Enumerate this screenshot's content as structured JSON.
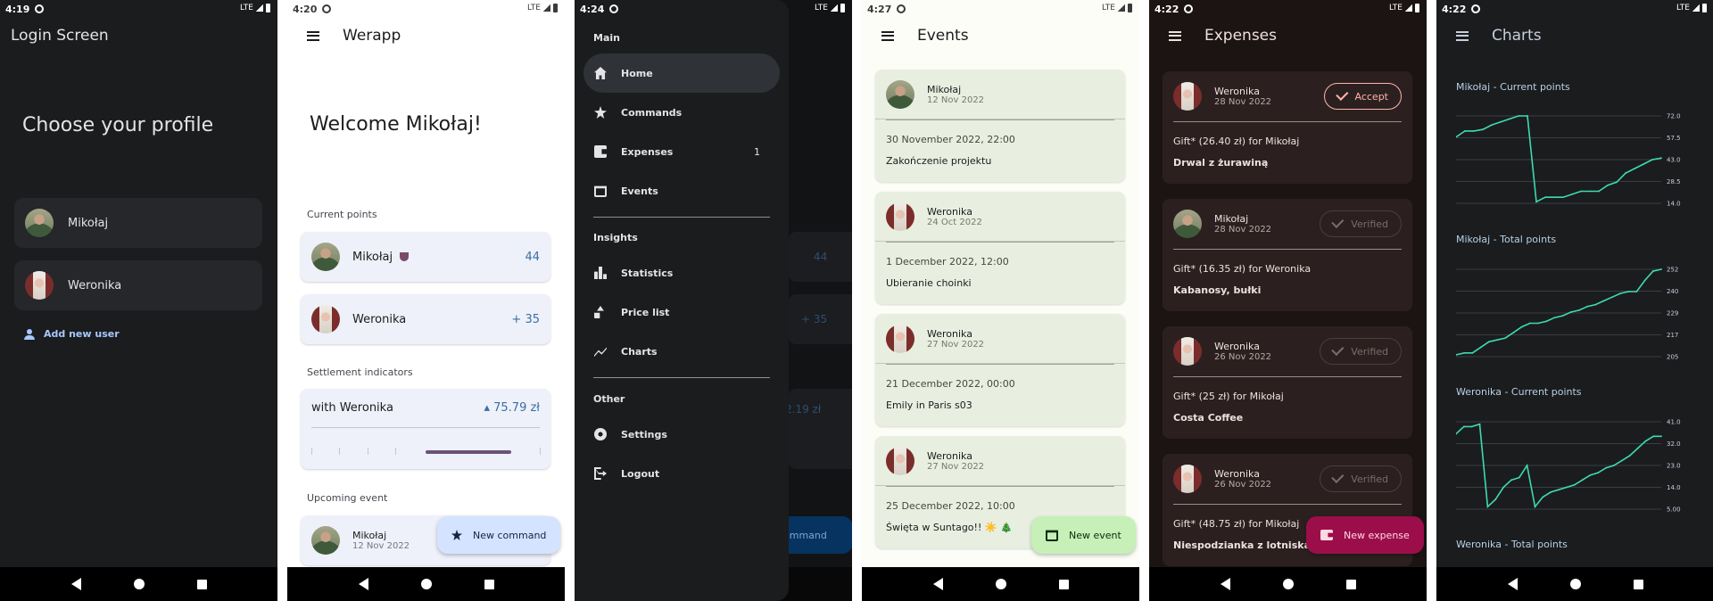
{
  "screen1": {
    "status": {
      "time": "4:19",
      "network": "LTE"
    },
    "app_title": "Login Screen",
    "heading": "Choose your profile",
    "profiles": [
      {
        "name": "Mikołaj"
      },
      {
        "name": "Weronika"
      }
    ],
    "add_user": "Add new user"
  },
  "screen2": {
    "status": {
      "time": "4:20",
      "network": "LTE"
    },
    "title": "Werapp",
    "welcome": "Welcome Mikołaj!",
    "current_points_label": "Current points",
    "points": [
      {
        "name": "Mikołaj",
        "value": "44"
      },
      {
        "name": "Weronika",
        "value": "+ 35"
      }
    ],
    "settlement_label": "Settlement indicators",
    "settlement": {
      "with": "with Weronika",
      "amount": "▴ 75.79 zł"
    },
    "upcoming_label": "Upcoming event",
    "upcoming": {
      "name": "Mikołaj",
      "date": "12 Nov 2022"
    },
    "fab": "New command"
  },
  "screen3": {
    "status": {
      "time": "4:24",
      "network": "LTE"
    },
    "sections": {
      "main": "Main",
      "insights": "Insights",
      "other": "Other"
    },
    "items": {
      "home": "Home",
      "commands": "Commands",
      "expenses": "Expenses",
      "expenses_badge": "1",
      "events": "Events",
      "statistics": "Statistics",
      "price_list": "Price list",
      "charts": "Charts",
      "settings": "Settings",
      "logout": "Logout"
    },
    "behind": {
      "points": "44",
      "points2": "+ 35",
      "amount": "2.19 zł",
      "fab": "ommand"
    }
  },
  "screen4": {
    "status": {
      "time": "4:27",
      "network": "LTE"
    },
    "title": "Events",
    "events": [
      {
        "name": "Mikołaj",
        "date": "12 Nov 2022",
        "when": "30 November 2022, 22:00",
        "what": "Zakończenie projektu"
      },
      {
        "name": "Weronika",
        "date": "24 Oct 2022",
        "when": "1 December 2022, 12:00",
        "what": "Ubieranie choinki"
      },
      {
        "name": "Weronika",
        "date": "27 Nov 2022",
        "when": "21 December 2022, 00:00",
        "what": "Emily in Paris s03"
      },
      {
        "name": "Weronika",
        "date": "27 Nov 2022",
        "when": "25 December 2022, 10:00",
        "what": "Święta w Suntago!! ☀️ 🎄"
      }
    ],
    "fab": "New event"
  },
  "screen5": {
    "status": {
      "time": "4:22",
      "network": "LTE"
    },
    "title": "Expenses",
    "expenses": [
      {
        "name": "Weronika",
        "date": "28 Nov 2022",
        "status": "Accept",
        "what": "Gift* (26.40 zł) for Mikołaj",
        "note": "Drwal z żurawiną"
      },
      {
        "name": "Mikołaj",
        "date": "28 Nov 2022",
        "status": "Verified",
        "what": "Gift* (16.35 zł) for Weronika",
        "note": "Kabanosy, bułki"
      },
      {
        "name": "Weronika",
        "date": "26 Nov 2022",
        "status": "Verified",
        "what": "Gift* (25 zł) for Mikołaj",
        "note": "Costa Coffee"
      },
      {
        "name": "Weronika",
        "date": "26 Nov 2022",
        "status": "Verified",
        "what": "Gift* (48.75 zł) for Mikołaj",
        "note": "Niespodzianka z lotniska"
      }
    ],
    "fab": "New expense"
  },
  "screen6": {
    "status": {
      "time": "4:22",
      "network": "LTE"
    },
    "title": "Charts",
    "accent": "#3ddbb0"
  },
  "chart_data": [
    {
      "type": "line",
      "title": "Mikołaj - Current points",
      "yticks": [
        "72.0",
        "57.5",
        "43.0",
        "28.5",
        "14.0"
      ],
      "ylim": [
        14.0,
        72.0
      ],
      "grid": true,
      "y": [
        58,
        62,
        62,
        63,
        66,
        68,
        70,
        72,
        72,
        15,
        18,
        18,
        18,
        20,
        22,
        22,
        22,
        26,
        28,
        34,
        37,
        40,
        43,
        44
      ]
    },
    {
      "type": "line",
      "title": "Mikołaj - Total points",
      "yticks": [
        "252",
        "240",
        "229",
        "217",
        "205"
      ],
      "ylim": [
        205,
        252
      ],
      "grid": true,
      "y": [
        206,
        207,
        207,
        210,
        213,
        214,
        215,
        218,
        221,
        223,
        223,
        224,
        226,
        227,
        229,
        230,
        232,
        233,
        235,
        237,
        239,
        240,
        240,
        246,
        251,
        252
      ]
    },
    {
      "type": "line",
      "title": "Weronika - Current points",
      "yticks": [
        "41.0",
        "32.0",
        "23.0",
        "14.0",
        "5.00"
      ],
      "ylim": [
        5.0,
        41.0
      ],
      "grid": true,
      "y": [
        36,
        39,
        39,
        40,
        6,
        9,
        14,
        17,
        18,
        23,
        6,
        10,
        12,
        13,
        14,
        15,
        17,
        19,
        20,
        22,
        23,
        25,
        27,
        30,
        33,
        35,
        35
      ]
    },
    {
      "type": "line",
      "title": "Weronika - Total points"
    }
  ]
}
